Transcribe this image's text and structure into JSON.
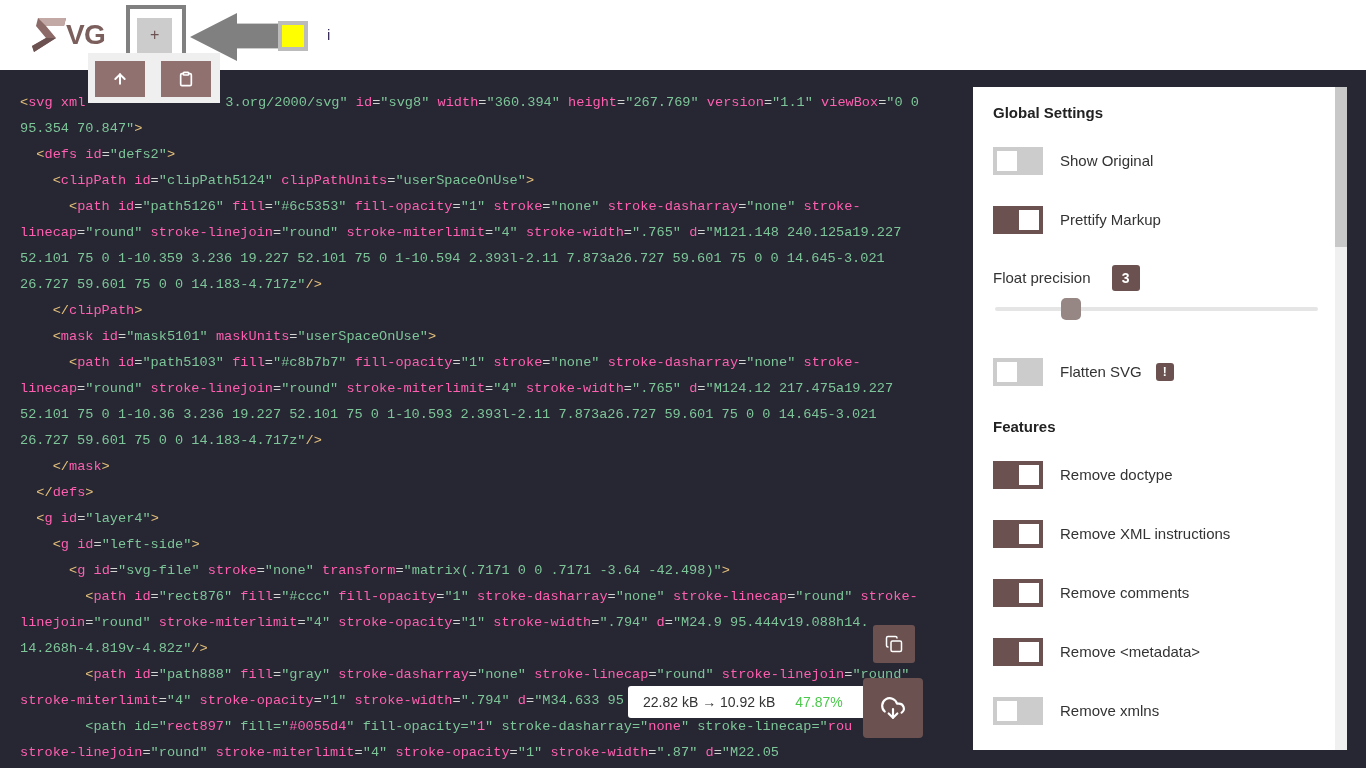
{
  "header": {
    "logo_text": "VG",
    "add_button": "+",
    "info": "i"
  },
  "code_lines": [
    {
      "parts": [
        "<svg xml",
        "3.org/2000/svg\" id=\"svg8\" width=\"360.394\" height=\"267.769\" version=\"1.1\" viewBox=\"0 0"
      ]
    },
    {
      "parts": [
        "95.354 70.847\">"
      ]
    },
    {
      "parts": [
        "  <defs id=\"defs2\">"
      ]
    },
    {
      "parts": [
        "    <clipPath id=\"clipPath5124\" clipPathUnits=\"userSpaceOnUse\">"
      ]
    },
    {
      "parts": [
        "      <path id=\"path5126\" fill=\"#6c5353\" fill-opacity=\"1\" stroke=\"none\" stroke-dasharray=\"none\" stroke-"
      ]
    },
    {
      "parts": [
        "linecap=\"round\" stroke-linejoin=\"round\" stroke-miterlimit=\"4\" stroke-width=\".765\" d=\"M121.148 240.125a19.227"
      ]
    },
    {
      "parts": [
        "52.101 75 0 1-10.359 3.236 19.227 52.101 75 0 1-10.594 2.393l-2.11 7.873a26.727 59.601 75 0 0 14.645-3.021"
      ]
    },
    {
      "parts": [
        "26.727 59.601 75 0 0 14.183-4.717z\"/>"
      ]
    },
    {
      "parts": [
        "    </clipPath>"
      ]
    },
    {
      "parts": [
        "    <mask id=\"mask5101\" maskUnits=\"userSpaceOnUse\">"
      ]
    },
    {
      "parts": [
        "      <path id=\"path5103\" fill=\"#c8b7b7\" fill-opacity=\"1\" stroke=\"none\" stroke-dasharray=\"none\" stroke-"
      ]
    },
    {
      "parts": [
        "linecap=\"round\" stroke-linejoin=\"round\" stroke-miterlimit=\"4\" stroke-width=\".765\" d=\"M124.12 217.475a19.227"
      ]
    },
    {
      "parts": [
        "52.101 75 0 1-10.36 3.236 19.227 52.101 75 0 1-10.593 2.393l-2.11 7.873a26.727 59.601 75 0 0 14.645-3.021"
      ]
    },
    {
      "parts": [
        "26.727 59.601 75 0 0 14.183-4.717z\"/>"
      ]
    },
    {
      "parts": [
        "    </mask>"
      ]
    },
    {
      "parts": [
        "  </defs>"
      ]
    },
    {
      "parts": [
        "  <g id=\"layer4\">"
      ]
    },
    {
      "parts": [
        "    <g id=\"left-side\">"
      ]
    },
    {
      "parts": [
        "      <g id=\"svg-file\" stroke=\"none\" transform=\"matrix(.7171 0 0 .7171 -3.64 -42.498)\">"
      ]
    },
    {
      "parts": [
        "        <path id=\"rect876\" fill=\"#ccc\" fill-opacity=\"1\" stroke-dasharray=\"none\" stroke-linecap=\"round\" stroke-"
      ]
    },
    {
      "parts": [
        "linejoin=\"round\" stroke-miterlimit=\"4\" stroke-opacity=\"1\" stroke-width=\".794\" d=\"M24.9 95.444v19.088h14."
      ]
    },
    {
      "parts": [
        "14.268h-4.819v-4.82z\"/>"
      ]
    },
    {
      "parts": [
        "        <path id=\"path888\" fill=\"gray\" stroke-dasharray=\"none\" stroke-linecap=\"round\" stroke-linejoin=\"round\""
      ]
    },
    {
      "parts": [
        "stroke-miterlimit=\"4\" stroke-opacity=\"1\" stroke-width=\".794\" d=\"M34.633 95"
      ]
    },
    {
      "parts": [
        "        <path id=\"rect897\" fill=\"#0055d4\" fill-opacity=\"1\" stroke-dasharray=\"none\" stroke-linecap=\"rou"
      ]
    },
    {
      "parts": [
        "stroke-linejoin=\"round\" stroke-miterlimit=\"4\" stroke-opacity=\"1\" stroke-width=\".87\" d=\"M22.05"
      ]
    }
  ],
  "stats": {
    "sizes": "22.82 kB → 10.92 kB",
    "saving": "47.87%"
  },
  "settings": [
    {
      "kind": "heading",
      "label": "Global Settings"
    },
    {
      "kind": "toggle",
      "label": "Show Original",
      "on": false
    },
    {
      "kind": "toggle",
      "label": "Prettify Markup",
      "on": true
    },
    {
      "kind": "slider",
      "label": "Float precision",
      "value": "3",
      "level": 0.235
    },
    {
      "kind": "toggle",
      "label": "Flatten SVG",
      "on": false,
      "badge": "!"
    },
    {
      "kind": "heading",
      "label": "Features"
    },
    {
      "kind": "toggle",
      "label": "Remove doctype",
      "on": true
    },
    {
      "kind": "toggle",
      "label": "Remove XML instructions",
      "on": true
    },
    {
      "kind": "toggle",
      "label": "Remove comments",
      "on": true
    },
    {
      "kind": "toggle",
      "label": "Remove <metadata>",
      "on": true
    },
    {
      "kind": "toggle",
      "label": "Remove xmlns",
      "on": false
    }
  ]
}
